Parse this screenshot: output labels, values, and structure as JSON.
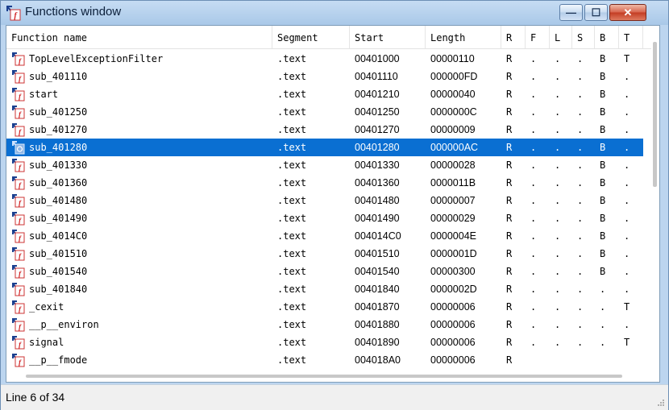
{
  "window": {
    "title": "Functions window"
  },
  "title_buttons": {
    "minimize": "—",
    "maximize": "☐",
    "close": "✕"
  },
  "columns": [
    {
      "label": "Function name"
    },
    {
      "label": "Segment"
    },
    {
      "label": "Start"
    },
    {
      "label": "Length"
    },
    {
      "label": "R"
    },
    {
      "label": "F"
    },
    {
      "label": "L"
    },
    {
      "label": "S"
    },
    {
      "label": "B"
    },
    {
      "label": "T"
    }
  ],
  "rows": [
    {
      "name": "TopLevelExceptionFilter",
      "segment": ".text",
      "start": "00401000",
      "length": "00000110",
      "r": "R",
      "f": ".",
      "l": ".",
      "s": ".",
      "b": "B",
      "t": "T"
    },
    {
      "name": "sub_401110",
      "segment": ".text",
      "start": "00401110",
      "length": "000000FD",
      "r": "R",
      "f": ".",
      "l": ".",
      "s": ".",
      "b": "B",
      "t": "."
    },
    {
      "name": "start",
      "segment": ".text",
      "start": "00401210",
      "length": "00000040",
      "r": "R",
      "f": ".",
      "l": ".",
      "s": ".",
      "b": "B",
      "t": "."
    },
    {
      "name": "sub_401250",
      "segment": ".text",
      "start": "00401250",
      "length": "0000000C",
      "r": "R",
      "f": ".",
      "l": ".",
      "s": ".",
      "b": "B",
      "t": "."
    },
    {
      "name": "sub_401270",
      "segment": ".text",
      "start": "00401270",
      "length": "00000009",
      "r": "R",
      "f": ".",
      "l": ".",
      "s": ".",
      "b": "B",
      "t": "."
    },
    {
      "name": "sub_401280",
      "segment": ".text",
      "start": "00401280",
      "length": "000000AC",
      "r": "R",
      "f": ".",
      "l": ".",
      "s": ".",
      "b": "B",
      "t": ".",
      "selected": true
    },
    {
      "name": "sub_401330",
      "segment": ".text",
      "start": "00401330",
      "length": "00000028",
      "r": "R",
      "f": ".",
      "l": ".",
      "s": ".",
      "b": "B",
      "t": "."
    },
    {
      "name": "sub_401360",
      "segment": ".text",
      "start": "00401360",
      "length": "0000011B",
      "r": "R",
      "f": ".",
      "l": ".",
      "s": ".",
      "b": "B",
      "t": "."
    },
    {
      "name": "sub_401480",
      "segment": ".text",
      "start": "00401480",
      "length": "00000007",
      "r": "R",
      "f": ".",
      "l": ".",
      "s": ".",
      "b": "B",
      "t": "."
    },
    {
      "name": "sub_401490",
      "segment": ".text",
      "start": "00401490",
      "length": "00000029",
      "r": "R",
      "f": ".",
      "l": ".",
      "s": ".",
      "b": "B",
      "t": "."
    },
    {
      "name": "sub_4014C0",
      "segment": ".text",
      "start": "004014C0",
      "length": "0000004E",
      "r": "R",
      "f": ".",
      "l": ".",
      "s": ".",
      "b": "B",
      "t": "."
    },
    {
      "name": "sub_401510",
      "segment": ".text",
      "start": "00401510",
      "length": "0000001D",
      "r": "R",
      "f": ".",
      "l": ".",
      "s": ".",
      "b": "B",
      "t": "."
    },
    {
      "name": "sub_401540",
      "segment": ".text",
      "start": "00401540",
      "length": "00000300",
      "r": "R",
      "f": ".",
      "l": ".",
      "s": ".",
      "b": "B",
      "t": "."
    },
    {
      "name": "sub_401840",
      "segment": ".text",
      "start": "00401840",
      "length": "0000002D",
      "r": "R",
      "f": ".",
      "l": ".",
      "s": ".",
      "b": ".",
      "t": "."
    },
    {
      "name": "_cexit",
      "segment": ".text",
      "start": "00401870",
      "length": "00000006",
      "r": "R",
      "f": ".",
      "l": ".",
      "s": ".",
      "b": ".",
      "t": "T"
    },
    {
      "name": "__p__environ",
      "segment": ".text",
      "start": "00401880",
      "length": "00000006",
      "r": "R",
      "f": ".",
      "l": ".",
      "s": ".",
      "b": ".",
      "t": "."
    },
    {
      "name": "signal",
      "segment": ".text",
      "start": "00401890",
      "length": "00000006",
      "r": "R",
      "f": ".",
      "l": ".",
      "s": ".",
      "b": ".",
      "t": "T"
    },
    {
      "name": "__p__fmode",
      "segment": ".text",
      "start": "004018A0",
      "length": "00000006",
      "r": "R",
      "f": "",
      "l": "",
      "s": "",
      "b": "",
      "t": ""
    }
  ],
  "status": {
    "text": "Line 6 of 34"
  },
  "colors": {
    "selection": "#0a6fd2",
    "icon_red": "#d12020",
    "icon_arrow": "#1a3f8f"
  },
  "icons": {
    "title": "function-icon",
    "row": "function-icon",
    "row_selected": "function-selected-icon"
  }
}
